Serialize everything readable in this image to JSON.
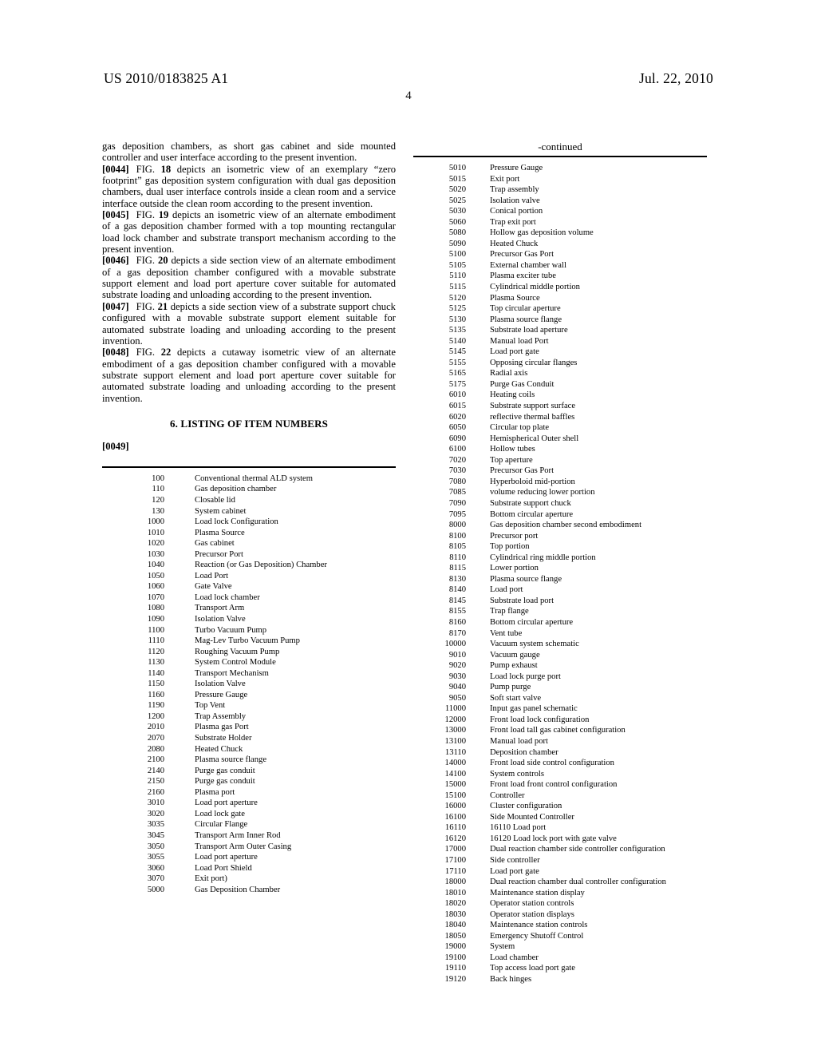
{
  "header": {
    "publication_number": "US 2010/0183825 A1",
    "publication_date": "Jul. 22, 2010",
    "page_number": "4"
  },
  "left_column": {
    "continued_paragraph": "gas deposition chambers, as short gas cabinet and side mounted controller and user interface according to the present invention.",
    "paragraphs": [
      {
        "tag": "[0044]",
        "lead": "FIG.",
        "fig": "18",
        "text": "depicts an isometric view of an exemplary “zero footprint” gas deposition system configuration with dual gas deposition chambers, dual user interface controls inside a clean room and a service interface outside the clean room according to the present invention."
      },
      {
        "tag": "[0045]",
        "lead": "FIG.",
        "fig": "19",
        "text": "depicts an isometric view of an alternate embodiment of a gas deposition chamber formed with a top mounting rectangular load lock chamber and substrate transport mechanism according to the present invention."
      },
      {
        "tag": "[0046]",
        "lead": "FIG.",
        "fig": "20",
        "text": "depicts a side section view of an alternate embodiment of a gas deposition chamber configured with a movable substrate support element and load port aperture cover suitable for automated substrate loading and unloading according to the present invention."
      },
      {
        "tag": "[0047]",
        "lead": "FIG.",
        "fig": "21",
        "text": "depicts a side section view of a substrate support chuck configured with a movable substrate support element suitable for automated substrate loading and unloading according to the present invention."
      },
      {
        "tag": "[0048]",
        "lead": "FIG.",
        "fig": "22",
        "text": "depicts a cutaway isometric view of an alternate embodiment of a gas deposition chamber configured with a movable substrate support element and load port aperture cover suitable for automated substrate loading and unloading according to the present invention."
      }
    ],
    "section_heading": "6. LISTING OF ITEM NUMBERS",
    "listing_tag": "[0049]"
  },
  "item_table_left": {
    "rows": [
      {
        "number": "100",
        "description": "Conventional thermal ALD system"
      },
      {
        "number": "110",
        "description": "Gas deposition chamber"
      },
      {
        "number": "120",
        "description": "Closable lid"
      },
      {
        "number": "130",
        "description": "System cabinet"
      },
      {
        "number": "1000",
        "description": "Load lock Configuration"
      },
      {
        "number": "1010",
        "description": "Plasma Source"
      },
      {
        "number": "1020",
        "description": "Gas cabinet"
      },
      {
        "number": "1030",
        "description": "Precursor Port"
      },
      {
        "number": "1040",
        "description": "Reaction (or Gas Deposition) Chamber"
      },
      {
        "number": "1050",
        "description": "Load Port"
      },
      {
        "number": "1060",
        "description": "Gate Valve"
      },
      {
        "number": "1070",
        "description": "Load lock chamber"
      },
      {
        "number": "1080",
        "description": "Transport Arm"
      },
      {
        "number": "1090",
        "description": "Isolation Valve"
      },
      {
        "number": "1100",
        "description": "Turbo Vacuum Pump"
      },
      {
        "number": "1110",
        "description": "Mag-Lev Turbo Vacuum Pump"
      },
      {
        "number": "1120",
        "description": "Roughing Vacuum Pump"
      },
      {
        "number": "1130",
        "description": "System Control Module"
      },
      {
        "number": "1140",
        "description": "Transport Mechanism"
      },
      {
        "number": "1150",
        "description": "Isolation Valve"
      },
      {
        "number": "1160",
        "description": "Pressure Gauge"
      },
      {
        "number": "1190",
        "description": "Top Vent"
      },
      {
        "number": "1200",
        "description": "Trap Assembly"
      },
      {
        "number": "2010",
        "description": "Plasma gas Port"
      },
      {
        "number": "2070",
        "description": "Substrate Holder"
      },
      {
        "number": "2080",
        "description": "Heated Chuck"
      },
      {
        "number": "2100",
        "description": "Plasma source flange"
      },
      {
        "number": "2140",
        "description": "Purge gas conduit"
      },
      {
        "number": "2150",
        "description": "Purge gas conduit"
      },
      {
        "number": "2160",
        "description": "Plasma port"
      },
      {
        "number": "3010",
        "description": "Load port aperture"
      },
      {
        "number": "3020",
        "description": "Load lock gate"
      },
      {
        "number": "3035",
        "description": "Circular Flange"
      },
      {
        "number": "3045",
        "description": "Transport Arm Inner Rod"
      },
      {
        "number": "3050",
        "description": "Transport Arm Outer Casing"
      },
      {
        "number": "3055",
        "description": "Load port aperture"
      },
      {
        "number": "3060",
        "description": "Load Port Shield"
      },
      {
        "number": "3070",
        "description": "Exit port)"
      },
      {
        "number": "5000",
        "description": "Gas Deposition Chamber"
      }
    ]
  },
  "item_table_right": {
    "continued_label": "-continued",
    "rows": [
      {
        "number": "5010",
        "description": "Pressure Gauge"
      },
      {
        "number": "5015",
        "description": "Exit port"
      },
      {
        "number": "5020",
        "description": "Trap assembly"
      },
      {
        "number": "5025",
        "description": "Isolation valve"
      },
      {
        "number": "5030",
        "description": "Conical portion"
      },
      {
        "number": "5060",
        "description": "Trap exit port"
      },
      {
        "number": "5080",
        "description": "Hollow gas deposition volume"
      },
      {
        "number": "5090",
        "description": "Heated Chuck"
      },
      {
        "number": "5100",
        "description": "Precursor Gas Port"
      },
      {
        "number": "5105",
        "description": "External chamber wall"
      },
      {
        "number": "5110",
        "description": "Plasma exciter tube"
      },
      {
        "number": "5115",
        "description": "Cylindrical middle portion"
      },
      {
        "number": "5120",
        "description": "Plasma Source"
      },
      {
        "number": "5125",
        "description": "Top circular aperture"
      },
      {
        "number": "5130",
        "description": "Plasma source flange"
      },
      {
        "number": "5135",
        "description": "Substrate load aperture"
      },
      {
        "number": "5140",
        "description": "Manual load Port"
      },
      {
        "number": "5145",
        "description": "Load port gate"
      },
      {
        "number": "5155",
        "description": "Opposing circular flanges"
      },
      {
        "number": "5165",
        "description": "Radial axis"
      },
      {
        "number": "5175",
        "description": "Purge Gas Conduit"
      },
      {
        "number": "6010",
        "description": "Heating coils"
      },
      {
        "number": "6015",
        "description": "Substrate support surface"
      },
      {
        "number": "6020",
        "description": "reflective thermal baffles"
      },
      {
        "number": "6050",
        "description": "Circular top plate"
      },
      {
        "number": "6090",
        "description": "Hemispherical Outer shell"
      },
      {
        "number": "6100",
        "description": "Hollow tubes"
      },
      {
        "number": "7020",
        "description": "Top aperture"
      },
      {
        "number": "7030",
        "description": "Precursor Gas Port"
      },
      {
        "number": "7080",
        "description": "Hyperboloid mid-portion"
      },
      {
        "number": "7085",
        "description": "volume reducing lower portion"
      },
      {
        "number": "7090",
        "description": "Substrate support chuck"
      },
      {
        "number": "7095",
        "description": "Bottom circular aperture"
      },
      {
        "number": "8000",
        "description": "Gas deposition chamber second embodiment"
      },
      {
        "number": "8100",
        "description": "Precursor port"
      },
      {
        "number": "8105",
        "description": "Top portion"
      },
      {
        "number": "8110",
        "description": "Cylindrical ring middle portion"
      },
      {
        "number": "8115",
        "description": "Lower portion"
      },
      {
        "number": "8130",
        "description": "Plasma source flange"
      },
      {
        "number": "8140",
        "description": "Load port"
      },
      {
        "number": "8145",
        "description": "Substrate load port"
      },
      {
        "number": "8155",
        "description": "Trap flange"
      },
      {
        "number": "8160",
        "description": "Bottom circular aperture"
      },
      {
        "number": "8170",
        "description": "Vent tube"
      },
      {
        "number": "10000",
        "description": "Vacuum system schematic"
      },
      {
        "number": "9010",
        "description": "Vacuum gauge"
      },
      {
        "number": "9020",
        "description": "Pump exhaust"
      },
      {
        "number": "9030",
        "description": "Load lock purge port"
      },
      {
        "number": "9040",
        "description": "Pump purge"
      },
      {
        "number": "9050",
        "description": "Soft start valve"
      },
      {
        "number": "11000",
        "description": "Input gas panel schematic"
      },
      {
        "number": "12000",
        "description": "Front load lock configuration"
      },
      {
        "number": "13000",
        "description": "Front load tall gas cabinet configuration"
      },
      {
        "number": "13100",
        "description": "Manual load port"
      },
      {
        "number": "13110",
        "description": "Deposition chamber"
      },
      {
        "number": "14000",
        "description": "Front load side control configuration"
      },
      {
        "number": "14100",
        "description": "System controls"
      },
      {
        "number": "15000",
        "description": "Front load front control configuration"
      },
      {
        "number": "15100",
        "description": "Controller"
      },
      {
        "number": "16000",
        "description": "Cluster configuration"
      },
      {
        "number": "16100",
        "description": "Side Mounted Controller"
      },
      {
        "number": "16110",
        "description": "16110 Load port"
      },
      {
        "number": "16120",
        "description": "16120 Load lock port with gate valve"
      },
      {
        "number": "17000",
        "description": "Dual reaction chamber side controller configuration"
      },
      {
        "number": "17100",
        "description": "Side controller"
      },
      {
        "number": "17110",
        "description": "Load port gate"
      },
      {
        "number": "18000",
        "description": "Dual reaction chamber dual controller configuration"
      },
      {
        "number": "18010",
        "description": "Maintenance station display"
      },
      {
        "number": "18020",
        "description": "Operator station controls"
      },
      {
        "number": "18030",
        "description": "Operator station displays"
      },
      {
        "number": "18040",
        "description": "Maintenance station controls"
      },
      {
        "number": "18050",
        "description": "Emergency Shutoff Control"
      },
      {
        "number": "19000",
        "description": "System"
      },
      {
        "number": "19100",
        "description": "Load chamber"
      },
      {
        "number": "19110",
        "description": "Top access load port gate"
      },
      {
        "number": "19120",
        "description": "Back hinges"
      }
    ]
  }
}
